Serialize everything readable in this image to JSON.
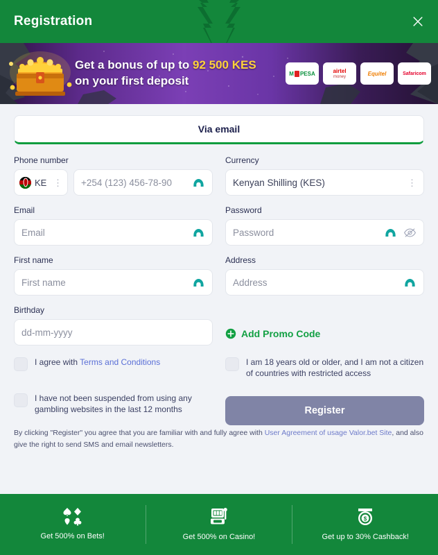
{
  "header": {
    "title": "Registration",
    "close_icon": "close-icon"
  },
  "banner": {
    "line1_prefix": "Get a bonus of up to ",
    "amount": "92 500 KES",
    "line2": "on your first deposit",
    "chest_icon": "treasure-chest-icon",
    "payment_logos": [
      {
        "name": "mpesa",
        "label": "PESA",
        "prefix": "M"
      },
      {
        "name": "airtel-money",
        "label": "airtel",
        "sub": "money"
      },
      {
        "name": "equitel",
        "label": "Equitel"
      },
      {
        "name": "safaricom",
        "label": "Safaricom"
      }
    ]
  },
  "form": {
    "tab_via_email": "Via email",
    "phone": {
      "label": "Phone number",
      "country_code": "KE",
      "country_flag": "kenya-flag-icon",
      "placeholder": "+254 (123) 456-78-90"
    },
    "currency": {
      "label": "Currency",
      "value": "Kenyan Shilling (KES)"
    },
    "email": {
      "label": "Email",
      "placeholder": "Email"
    },
    "password": {
      "label": "Password",
      "placeholder": "Password",
      "toggle_icon": "eye-off-icon"
    },
    "first_name": {
      "label": "First name",
      "placeholder": "First name"
    },
    "address": {
      "label": "Address",
      "placeholder": "Address"
    },
    "birthday": {
      "label": "Birthday",
      "placeholder": "dd-mm-yyyy"
    },
    "promo": {
      "label": "Add Promo Code",
      "icon": "plus-circle-icon"
    },
    "checkboxes": [
      {
        "text_prefix": "I agree with ",
        "link": "Terms and Conditions",
        "checked": false
      },
      {
        "text": "I am 18 years old or older, and I am not a citizen of countries with restricted access",
        "checked": false
      },
      {
        "text": "I have not been suspended from using any gambling websites in the last 12 months",
        "checked": false
      }
    ],
    "register_button": "Register",
    "disclaimer_prefix": "By clicking \"Register\" you agree that you are familiar with and fully agree with ",
    "disclaimer_link": "User Agreement of usage Valor.bet Site",
    "disclaimer_suffix": ", and also give the right to send SMS and email newsletters."
  },
  "footer": {
    "items": [
      {
        "icon": "card-suits-icon",
        "text": "Get 500% on Bets!"
      },
      {
        "icon": "slot-machine-icon",
        "text": "Get 500% on Casino!"
      },
      {
        "icon": "cashback-coin-icon",
        "text": "Get up to 30% Cashback!"
      }
    ]
  },
  "colors": {
    "brand_green": "#13873b",
    "accent_green": "#12a043",
    "banner_amount": "#ffd23b",
    "register_disabled": "#8084a6",
    "link_blue": "#5a6fd6",
    "nord_teal": "#10a5a0"
  }
}
